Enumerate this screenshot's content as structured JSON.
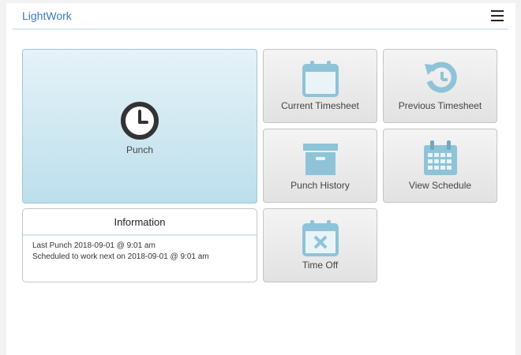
{
  "app": {
    "title": "LightWork"
  },
  "colors": {
    "accent": "#3a7bbf",
    "icon": "#8ec3d8",
    "tile_bg": "#e8e8e8",
    "punch_bg": "#c8e4ef"
  },
  "tiles": {
    "punch": {
      "label": "Punch",
      "icon": "clock-icon"
    },
    "current_timesheet": {
      "label": "Current Timesheet",
      "icon": "calendar-icon"
    },
    "previous_timesheet": {
      "label": "Previous Timesheet",
      "icon": "history-icon"
    },
    "punch_history": {
      "label": "Punch History",
      "icon": "archive-box-icon"
    },
    "view_schedule": {
      "label": "View Schedule",
      "icon": "calendar-grid-icon"
    },
    "time_off": {
      "label": "Time Off",
      "icon": "calendar-x-icon"
    }
  },
  "information": {
    "title": "Information",
    "last_punch": "Last Punch 2018-09-01 @ 9:01 am",
    "next_schedule": "Scheduled to work next on 2018-09-01 @ 9:01 am"
  }
}
